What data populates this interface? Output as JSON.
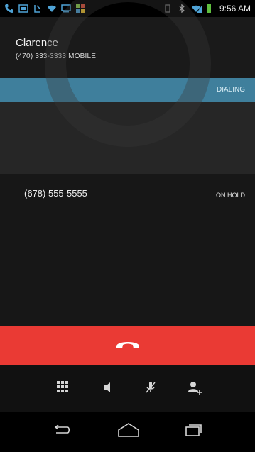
{
  "status_bar": {
    "time": "9:56 AM",
    "left_icons": [
      "phone-icon",
      "image-icon",
      "download-icon",
      "wifi-icon",
      "screen-icon",
      "grid-icon"
    ],
    "right_icons": [
      "vibrate-icon",
      "bluetooth-icon",
      "signal-icon",
      "battery-icon"
    ]
  },
  "active_call": {
    "name": "Clarence",
    "number_line": "(470) 333-3333  MOBILE",
    "status": "DIALING"
  },
  "held_call": {
    "number": "(678) 555-5555",
    "status": "ON HOLD"
  },
  "controls": {
    "dialpad": "dialpad-icon",
    "speaker": "speaker-icon",
    "mute": "mute-icon",
    "add_call": "add-call-icon"
  },
  "nav": {
    "back": "back-icon",
    "home": "home-icon",
    "recents": "recents-icon"
  },
  "colors": {
    "dialing_bar": "#3f7f9c",
    "end_call": "#ea3a34"
  }
}
